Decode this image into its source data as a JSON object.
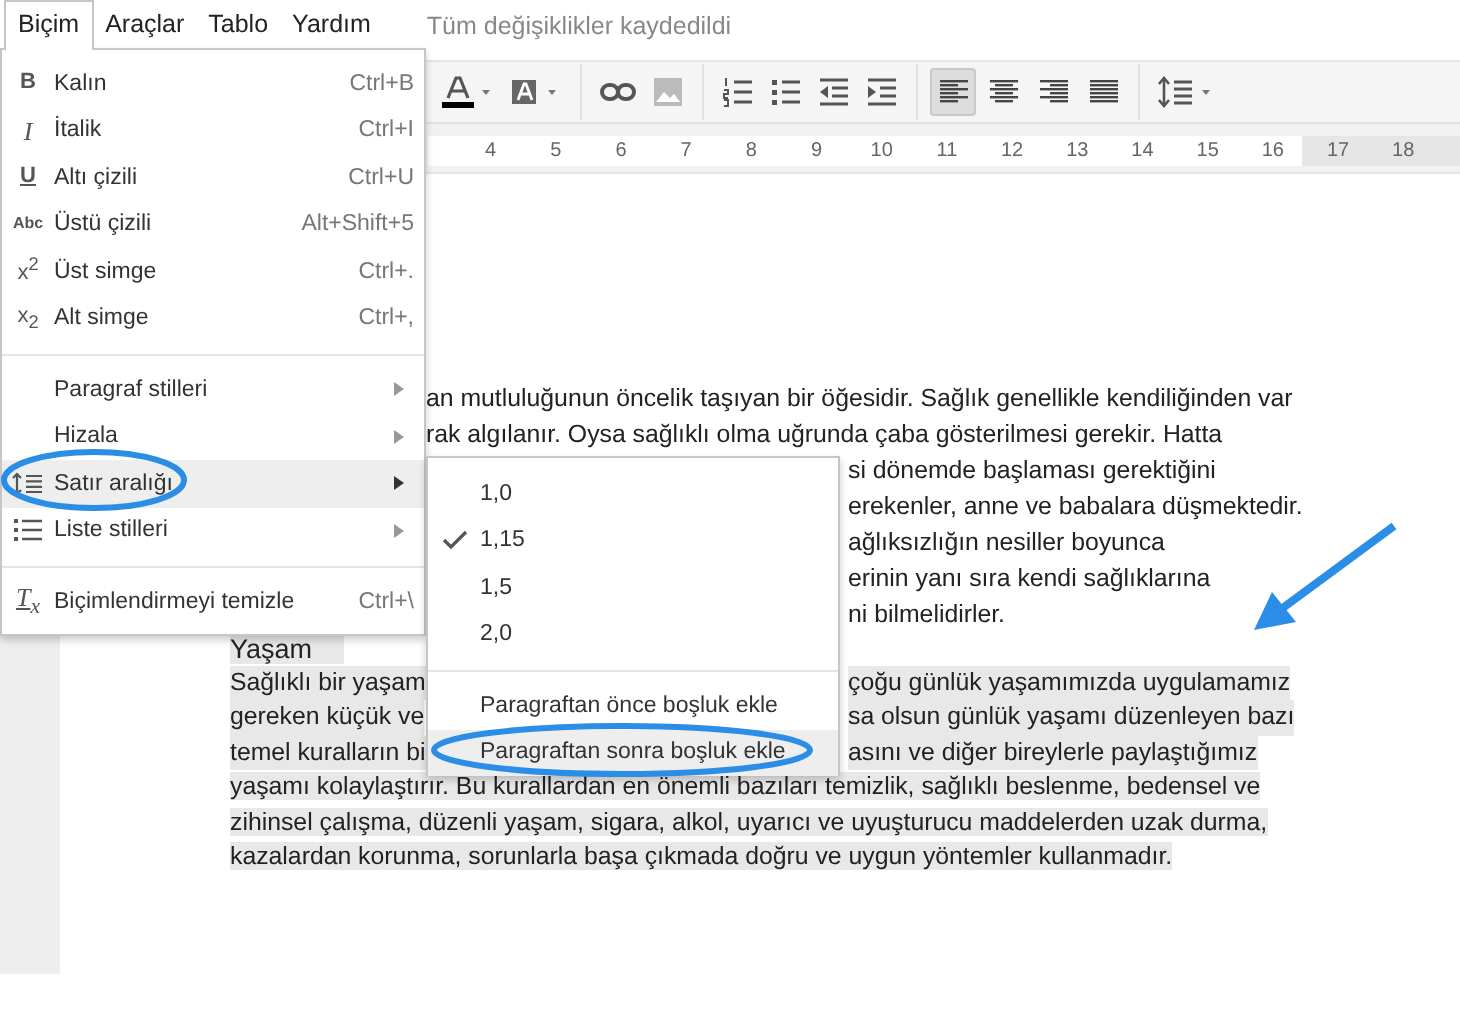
{
  "menubar": {
    "items": [
      {
        "label": "Biçim",
        "selected": true
      },
      {
        "label": "Araçlar",
        "selected": false
      },
      {
        "label": "Tablo",
        "selected": false
      },
      {
        "label": "Yardım",
        "selected": false
      }
    ],
    "status": "Tüm değişiklikler kaydedildi"
  },
  "toolbar": {
    "alignment": [
      {
        "selected": true
      },
      {
        "selected": false
      },
      {
        "selected": false
      },
      {
        "selected": false
      }
    ]
  },
  "ruler": {
    "numbers": [
      "4",
      "5",
      "6",
      "7",
      "8",
      "9",
      "10",
      "11",
      "12",
      "13",
      "14",
      "15",
      "16",
      "17",
      "18"
    ]
  },
  "document": {
    "paragraph_1": {
      "lines": [
        "an mutluluğunun öncelik taşıyan bir öğesidir. Sağlık genellikle kendiliğinden var",
        "rak algılanır. Oysa sağlıklı olma uğrunda çaba gösterilmesi gerekir. Hatta",
        "si dönemde başlaması gerektiğini",
        "erekenler, anne ve babalara düşmektedir.",
        "ağlıksızlığın nesiller boyunca",
        "erinin yanı sıra kendi sağlıklarına",
        "ni bilmelidirler."
      ]
    },
    "heading": {
      "text": "Yaşam",
      "selected": true
    },
    "paragraph_2": {
      "selected": true,
      "lines": [
        [
          "Sağlıklı bir yaşam",
          "çoğu günlük yaşamımızda  uygulamamız"
        ],
        [
          "gereken küçük ve",
          "sa olsun günlük yaşamı düzenleyen bazı"
        ],
        [
          "temel kuralların bi",
          "asını ve diğer bireylerle paylaştığımız"
        ],
        [
          "yaşamı kolaylaştırır. Bu kurallardan en önemli bazıları temizlik, sağlıklı beslenme, bedensel ve"
        ],
        [
          "zihinsel çalışma, düzenli yaşam, sigara, alkol, uyarıcı ve uyuşturucu maddelerden uzak durma,"
        ],
        [
          "kazalardan korunma, sorunlarla başa çıkmada doğru ve uygun yöntemler kullanmadır."
        ]
      ]
    }
  },
  "format_menu": {
    "items": [
      {
        "kind": "item",
        "glyph": "B",
        "label": "Kalın",
        "shortcut": "Ctrl+B"
      },
      {
        "kind": "item",
        "glyph": "I",
        "label": "İtalik",
        "shortcut": "Ctrl+I"
      },
      {
        "kind": "item",
        "glyph": "U",
        "label": "Altı çizili",
        "shortcut": "Ctrl+U"
      },
      {
        "kind": "item",
        "glyph": "Abc",
        "label": "Üstü çizili",
        "shortcut": "Alt+Shift+5"
      },
      {
        "kind": "item",
        "glyph": "x$^{2}$",
        "label": "Üst simge",
        "shortcut": "Ctrl+."
      },
      {
        "kind": "item",
        "glyph": "x$_{2}$",
        "label": "Alt simge",
        "shortcut": "Ctrl+,"
      },
      {
        "kind": "separator"
      },
      {
        "kind": "submenu",
        "label": "Paragraf stilleri",
        "selected": false
      },
      {
        "kind": "submenu",
        "label": "Hizala",
        "selected": false
      },
      {
        "kind": "submenu",
        "label": "Satır aralığı",
        "selected": true
      },
      {
        "kind": "submenu",
        "label": "Liste stilleri",
        "selected": false
      },
      {
        "kind": "separator"
      },
      {
        "kind": "item",
        "glyph": "T$_{x}$",
        "label": "Biçimlendirmeyi temizle",
        "shortcut": "Ctrl+\\"
      }
    ]
  },
  "line_spacing_menu": {
    "items": [
      {
        "kind": "option",
        "label": "1,0",
        "checked": false
      },
      {
        "kind": "option",
        "label": "1,15",
        "checked": true
      },
      {
        "kind": "option",
        "label": "1,5",
        "checked": false
      },
      {
        "kind": "option",
        "label": "2,0",
        "checked": false
      },
      {
        "kind": "separator"
      },
      {
        "kind": "action",
        "label": "Paragraftan önce boşluk ekle",
        "selected": false
      },
      {
        "kind": "action",
        "label": "Paragraftan sonra boşluk ekle",
        "selected": true
      }
    ]
  }
}
